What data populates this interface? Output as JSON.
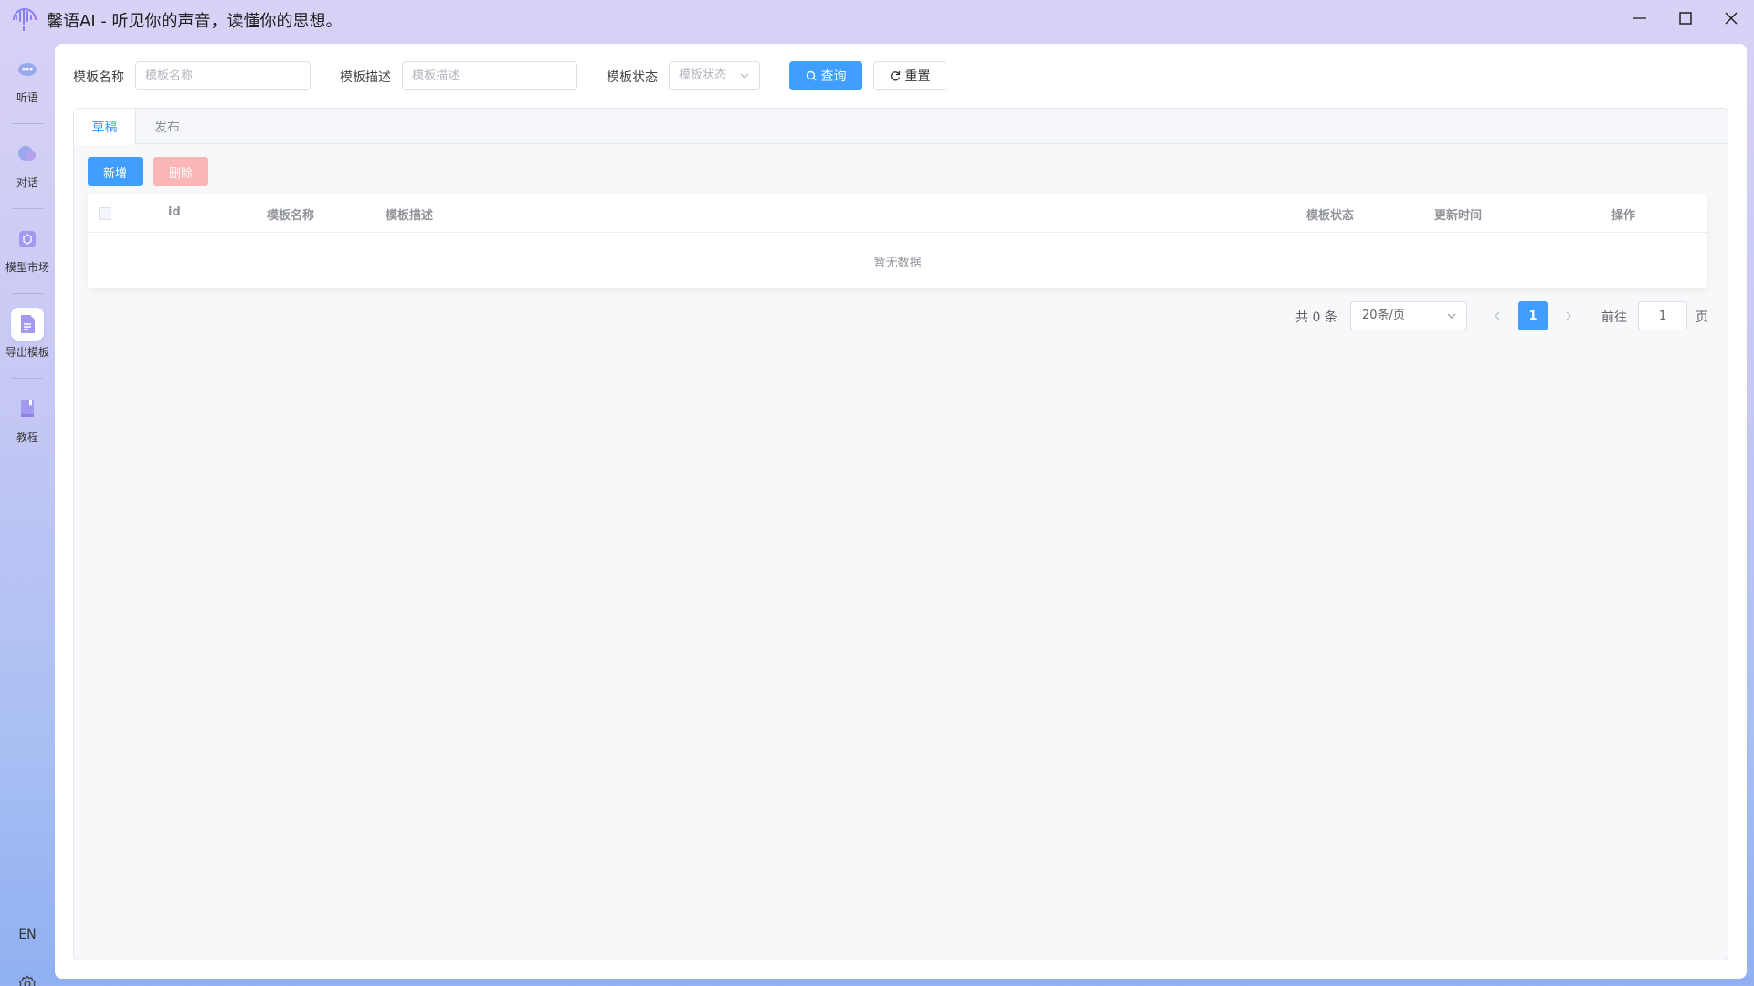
{
  "window": {
    "title": "馨语AI - 听见你的声音，读懂你的思想。"
  },
  "sidebar": {
    "items": [
      {
        "label": "听语",
        "icon": "ear-icon"
      },
      {
        "label": "对话",
        "icon": "chat-icon"
      },
      {
        "label": "模型市场",
        "icon": "cube-icon"
      },
      {
        "label": "导出模板",
        "icon": "document-icon",
        "active": true
      },
      {
        "label": "教程",
        "icon": "book-icon"
      }
    ],
    "lang": "EN"
  },
  "search": {
    "name_label": "模板名称",
    "name_placeholder": "模板名称",
    "desc_label": "模板描述",
    "desc_placeholder": "模板描述",
    "status_label": "模板状态",
    "status_placeholder": "模板状态",
    "query_label": "查询",
    "reset_label": "重置"
  },
  "tabs": [
    {
      "label": "草稿",
      "active": true
    },
    {
      "label": "发布",
      "active": false
    }
  ],
  "toolbar": {
    "add_label": "新增",
    "delete_label": "删除"
  },
  "table": {
    "columns": [
      "id",
      "模板名称",
      "模板描述",
      "模板状态",
      "更新时间",
      "操作"
    ],
    "rows": [],
    "empty_text": "暂无数据"
  },
  "pagination": {
    "total_text": "共 0 条",
    "page_size": "20条/页",
    "current_page": "1",
    "goto_label": "前往",
    "goto_value": "1",
    "page_suffix": "页"
  },
  "colors": {
    "primary": "#409eff",
    "danger_disabled": "#fab6b6"
  }
}
